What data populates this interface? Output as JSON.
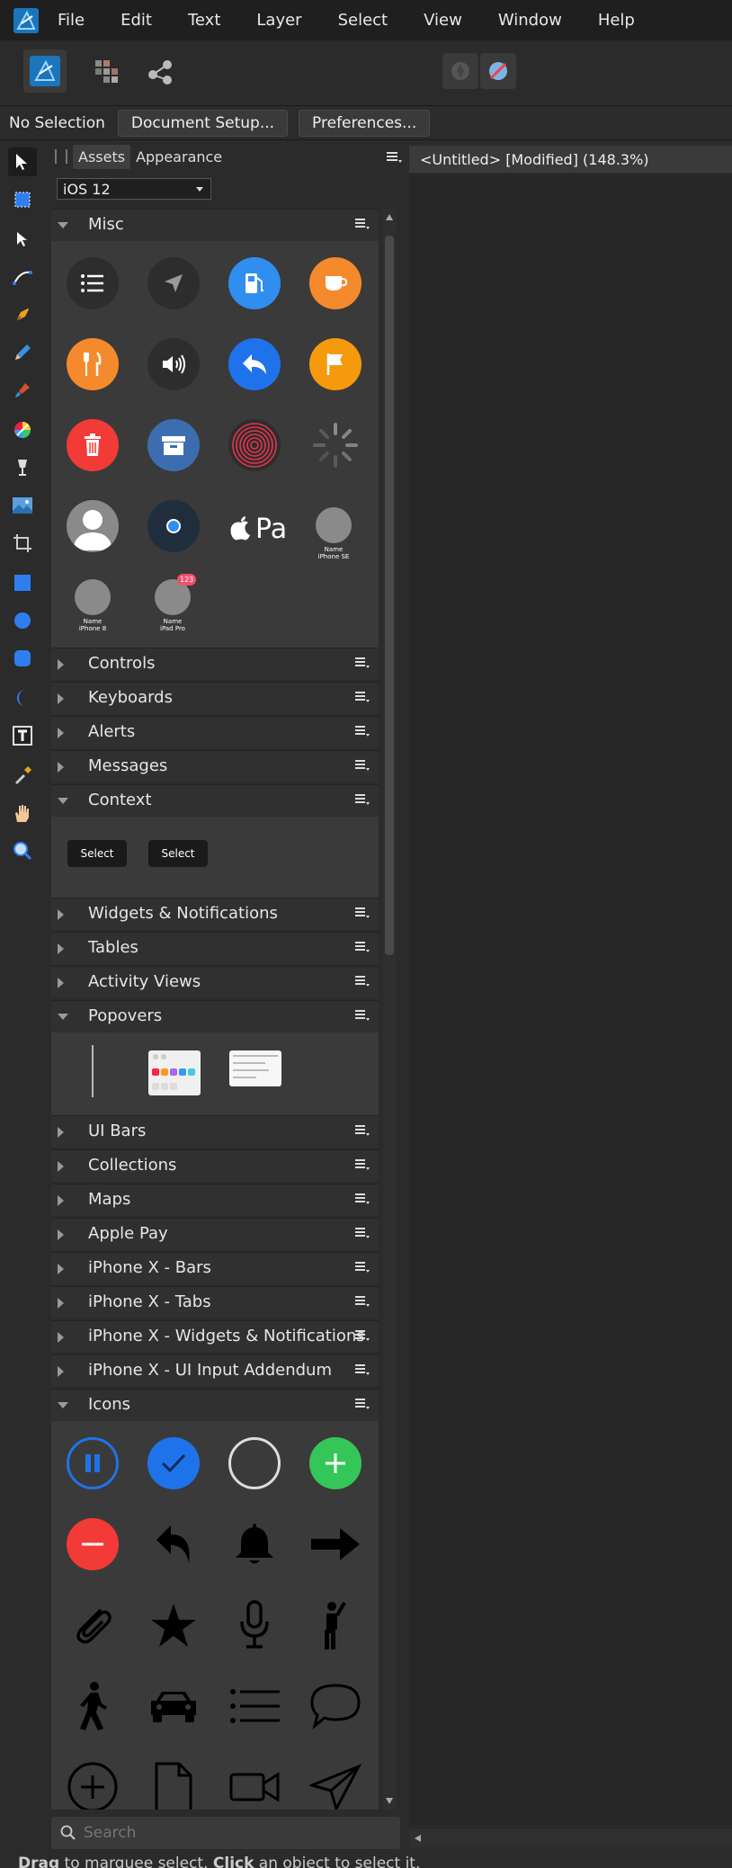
{
  "menu": [
    "File",
    "Edit",
    "Text",
    "Layer",
    "Select",
    "View",
    "Window",
    "Help"
  ],
  "context": {
    "selection": "No Selection",
    "document_setup": "Document Setup...",
    "preferences": "Preferences..."
  },
  "panel": {
    "tabs": [
      "Assets",
      "Appearance"
    ],
    "library": "iOS 12",
    "search_placeholder": "Search"
  },
  "categories": [
    {
      "label": "Misc",
      "open": true
    },
    {
      "label": "Controls",
      "open": false
    },
    {
      "label": "Keyboards",
      "open": false
    },
    {
      "label": "Alerts",
      "open": false
    },
    {
      "label": "Messages",
      "open": false
    },
    {
      "label": "Context",
      "open": true
    },
    {
      "label": "Widgets & Notifications",
      "open": false
    },
    {
      "label": "Tables",
      "open": false
    },
    {
      "label": "Activity Views",
      "open": false
    },
    {
      "label": "Popovers",
      "open": true
    },
    {
      "label": "UI Bars",
      "open": false
    },
    {
      "label": "Collections",
      "open": false
    },
    {
      "label": "Maps",
      "open": false
    },
    {
      "label": "Apple Pay",
      "open": false
    },
    {
      "label": "iPhone X - Bars",
      "open": false
    },
    {
      "label": "iPhone X - Tabs",
      "open": false
    },
    {
      "label": "iPhone X - Widgets & Notifications",
      "open": false
    },
    {
      "label": "iPhone X - UI Input Addendum",
      "open": false
    },
    {
      "label": "Icons",
      "open": true
    }
  ],
  "misc_assets": {
    "name_se": "Name",
    "device_se": "iPhone SE",
    "name_8": "Name",
    "device_8": "iPhone 8",
    "name_ipad": "Name",
    "device_ipad": "iPad Pro",
    "badge": "123",
    "pay_text": "Pa"
  },
  "context_assets": [
    "Select",
    "Select"
  ],
  "document": {
    "title": "<Untitled> [Modified] (148.3%)"
  },
  "status": {
    "drag": "Drag",
    "drag_text": " to marquee select. ",
    "click": "Click",
    "click_text": " an object to select it."
  },
  "colors": {
    "blue": "#2f7ef0",
    "orange": "#f58a2c",
    "red": "#f23b36",
    "green": "#35c659",
    "dark_circle": "#2f2f2f"
  }
}
